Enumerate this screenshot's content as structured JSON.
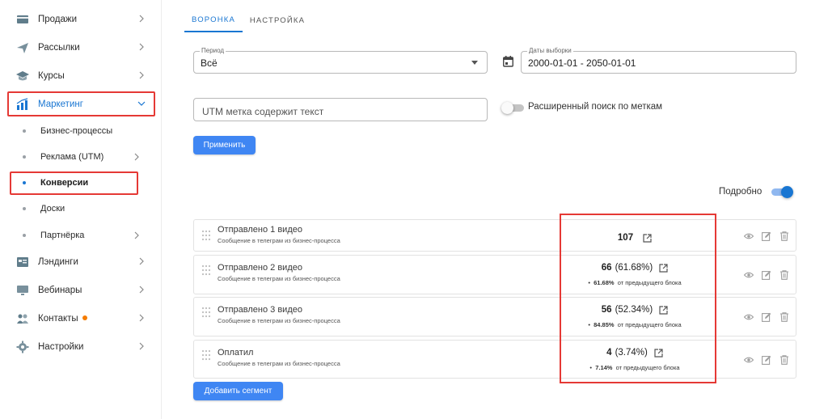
{
  "sidebar": {
    "items": [
      {
        "label": "Продажи",
        "icon": "cart-icon"
      },
      {
        "label": "Рассылки",
        "icon": "send-icon"
      },
      {
        "label": "Курсы",
        "icon": "graduation-cap-icon"
      },
      {
        "label": "Маркетинг",
        "icon": "bar-chart-icon",
        "expanded": true
      },
      {
        "label": "Лэндинги",
        "icon": "landing-page-icon"
      },
      {
        "label": "Вебинары",
        "icon": "monitor-icon"
      },
      {
        "label": "Контакты",
        "icon": "contacts-icon",
        "badge": true
      },
      {
        "label": "Настройки",
        "icon": "gear-icon"
      }
    ],
    "marketing_sub": [
      {
        "label": "Бизнес-процессы"
      },
      {
        "label": "Реклама (UTM)"
      },
      {
        "label": "Конверсии",
        "active": true
      },
      {
        "label": "Доски"
      },
      {
        "label": "Партнёрка"
      }
    ]
  },
  "tabs": [
    {
      "label": "ВОРОНКА",
      "active": true
    },
    {
      "label": "НАСТРОЙКА",
      "active": false
    }
  ],
  "filters": {
    "period_legend": "Период",
    "period_value": "Всё",
    "dates_legend": "Даты выборки",
    "dates_value": "2000-01-01 - 2050-01-01",
    "utm_placeholder": "UTM метка содержит текст",
    "advanced_search_label": "Расширенный поиск по меткам",
    "advanced_search_on": false,
    "apply_label": "Применить"
  },
  "detail_toggle": {
    "label": "Подробно",
    "on": true
  },
  "funnel": {
    "rows": [
      {
        "title": "Отправлено 1 видео",
        "subtitle": "Сообщение в телеграм из бизнес-процесса",
        "count": "107",
        "percent": "",
        "prev_percent": "",
        "prev_label": ""
      },
      {
        "title": "Отправлено 2 видео",
        "subtitle": "Сообщение в телеграм из бизнес-процесса",
        "count": "66",
        "percent": "(61.68%)",
        "prev_percent": "61.68%",
        "prev_label": "от предыдущего блока"
      },
      {
        "title": "Отправлено 3 видео",
        "subtitle": "Сообщение в телеграм из бизнес-процесса",
        "count": "56",
        "percent": "(52.34%)",
        "prev_percent": "84.85%",
        "prev_label": "от предыдущего блока"
      },
      {
        "title": "Оплатил",
        "subtitle": "Сообщение в телеграм из бизнес-процесса",
        "count": "4",
        "percent": "(3.74%)",
        "prev_percent": "7.14%",
        "prev_label": "от предыдущего блока"
      }
    ],
    "add_segment_label": "Добавить сегмент"
  },
  "colors": {
    "accent": "#1976d2",
    "button": "#3f86f3",
    "highlight": "#e53935",
    "badge": "#f57c00"
  }
}
